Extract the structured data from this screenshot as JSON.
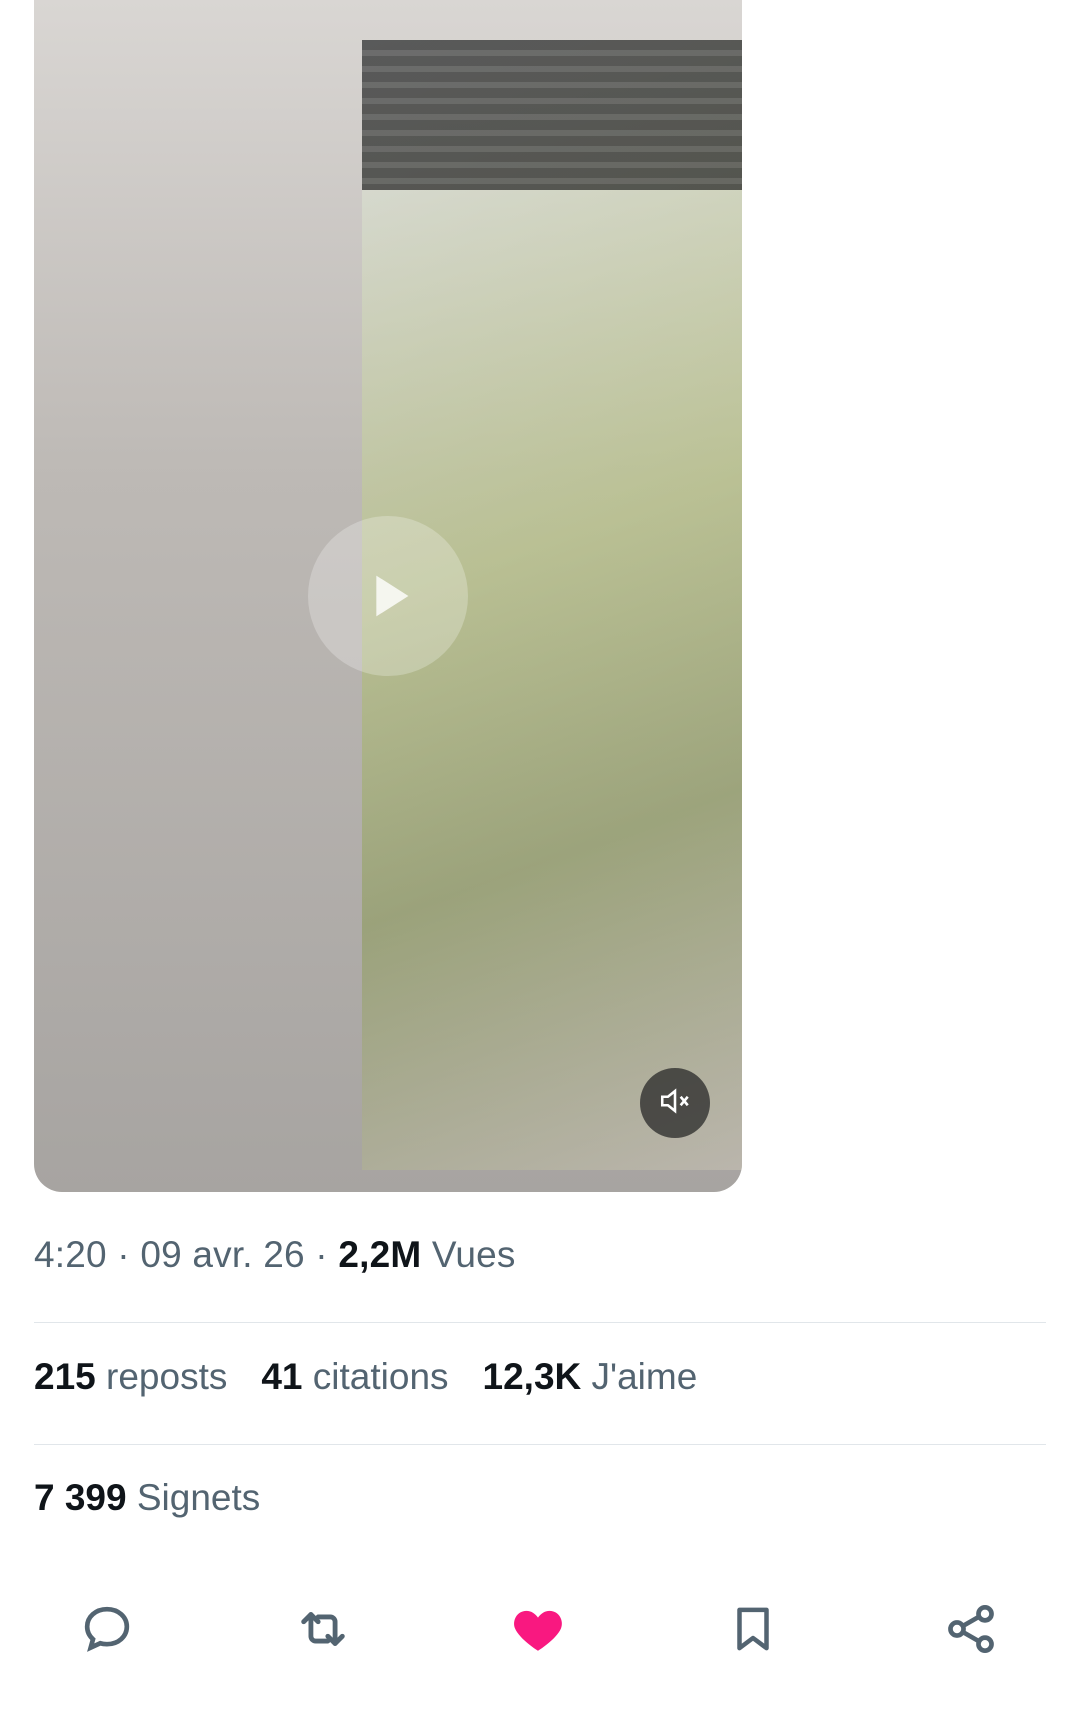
{
  "media": {
    "icon": "muted-speaker-icon"
  },
  "meta": {
    "time": "4:20",
    "sep1": " · ",
    "date": "09 avr. 26",
    "sep2": " · ",
    "views_count": "2,2M",
    "views_label": " Vues"
  },
  "stats": {
    "reposts_count": "215",
    "reposts_label": " reposts",
    "quotes_count": "41",
    "quotes_label": " citations",
    "likes_count": "12,3K",
    "likes_label": " J'aime"
  },
  "bookmarks": {
    "count": "7 399",
    "label": " Signets"
  },
  "actions": {
    "reply_icon": "reply-icon",
    "repost_icon": "repost-icon",
    "like_icon": "heart-icon",
    "bookmark_icon": "bookmark-icon",
    "share_icon": "share-icon",
    "like_color": "#f91880",
    "icon_color": "#536471"
  }
}
